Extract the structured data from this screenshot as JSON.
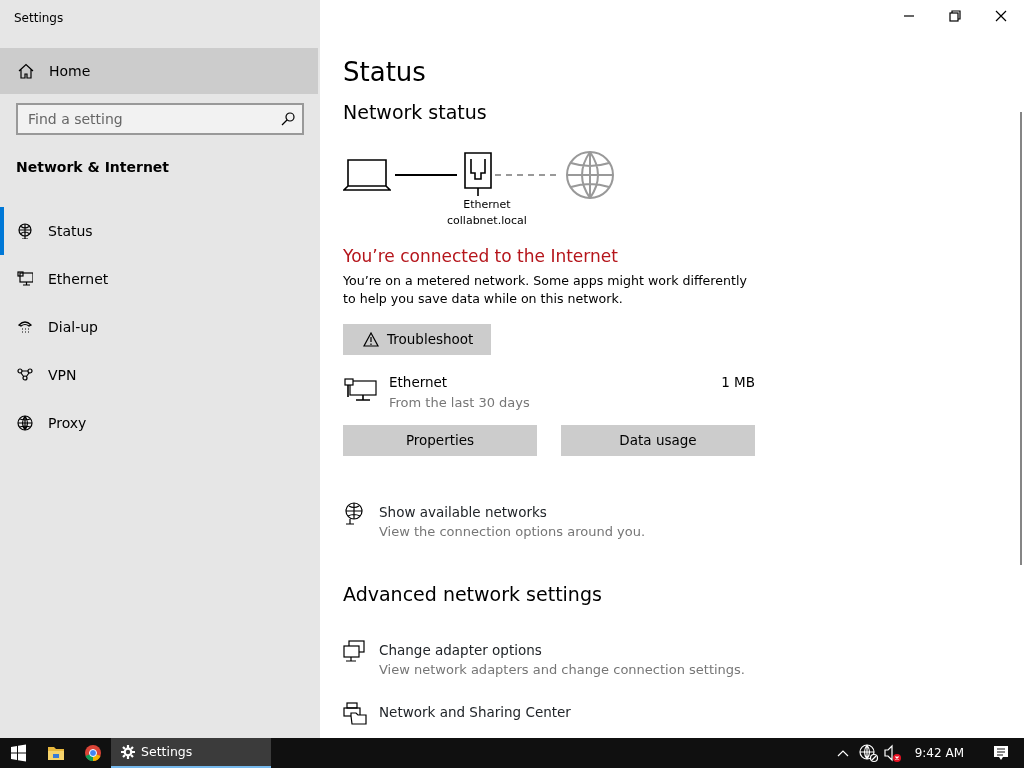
{
  "window": {
    "title": "Settings"
  },
  "sidebar": {
    "home": {
      "label": "Home",
      "hovered": true
    },
    "search": {
      "placeholder": "Find a setting"
    },
    "section": "Network & Internet",
    "items": [
      {
        "label": "Status",
        "kind": "status",
        "selected": true
      },
      {
        "label": "Ethernet",
        "kind": "ethernet",
        "selected": false
      },
      {
        "label": "Dial-up",
        "kind": "dialup",
        "selected": false
      },
      {
        "label": "VPN",
        "kind": "vpn",
        "selected": false
      },
      {
        "label": "Proxy",
        "kind": "proxy",
        "selected": false
      }
    ]
  },
  "main": {
    "title": "Status",
    "network_status": {
      "heading": "Network status",
      "adapter": "Ethernet",
      "domain": "collabnet.local",
      "internet": true
    },
    "connection_heading": "You’re connected to the Internet",
    "connection_text": "You’re on a metered network. Some apps might work differently to help you save data while on this network.",
    "troubleshoot": "Troubleshoot",
    "usage": {
      "name": "Ethernet",
      "period": "From the last 30 days",
      "amount": "1 MB"
    },
    "usage_buttons": [
      "Properties",
      "Data usage"
    ],
    "links": [
      {
        "title": "Show available networks",
        "description": "View the connection options around you.",
        "kind": "networks"
      }
    ],
    "advanced": {
      "heading": "Advanced network settings",
      "links": [
        {
          "title": "Change adapter options",
          "description": "View network adapters and change connection settings.",
          "kind": "adapter"
        },
        {
          "title": "Network and Sharing Center",
          "kind": "sharing"
        }
      ]
    }
  },
  "taskbar": {
    "apps": [
      {
        "kind": "explorer",
        "active": false
      },
      {
        "kind": "browser",
        "active": false
      },
      {
        "kind": "settings",
        "label": "Settings",
        "active": true
      }
    ],
    "time": "9:42 AM",
    "sound_muted": true,
    "network_blocked": true
  }
}
